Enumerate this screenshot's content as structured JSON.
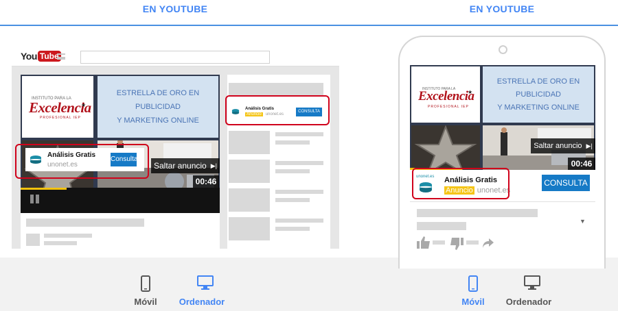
{
  "left_panel": {
    "heading": "EN YOUTUBE"
  },
  "right_panel": {
    "heading": "EN YOUTUBE"
  },
  "desktop_mockup": {
    "logo_you": "You",
    "logo_tube": "Tube",
    "logo_tagline": "INSTITUTO PARA LA",
    "logo_word": "Excelencia",
    "logo_sub": "PROFESIONAL IEP",
    "banner_lines": [
      "ESTRELLA DE ORO EN",
      "PUBLICIDAD",
      "Y MARKETING ONLINE"
    ],
    "overlay_ad": {
      "title": "Análisis Gratis",
      "domain": "unonet.es",
      "button": "Consulta"
    },
    "companion_ad": {
      "title": "Análisis Gratis",
      "badge": "Anuncio",
      "domain": "unonet.es",
      "button": "CONSULTA"
    },
    "skip_label": "Saltar anuncio",
    "time": "00:46",
    "progress": 0.23
  },
  "mobile_mockup": {
    "logo_tagline": "INSTITUTO PARA LA",
    "logo_word": "Excelencia",
    "logo_sub": "PROFESIONAL IEP",
    "banner_lines": [
      "ESTRELLA DE ORO EN",
      "PUBLICIDAD",
      "Y MARKETING ONLINE"
    ],
    "ad": {
      "title": "Análisis Gratis",
      "badge": "Anuncio",
      "domain": "unonet.es",
      "button": "CONSULTA",
      "icon_text": "unonet.es"
    },
    "skip_label": "Saltar anuncio",
    "time": "00:46",
    "progress": 0.28
  },
  "left_toggle": {
    "mobile": "Móvil",
    "desktop": "Ordenador",
    "active": "desktop"
  },
  "right_toggle": {
    "mobile": "Móvil",
    "desktop": "Ordenador",
    "active": "mobile"
  },
  "colors": {
    "accent": "#4285f4",
    "ad_button": "#167ac6",
    "highlight_box": "#d0021b",
    "ad_badge": "#f5c518",
    "inactive": "#555555"
  }
}
